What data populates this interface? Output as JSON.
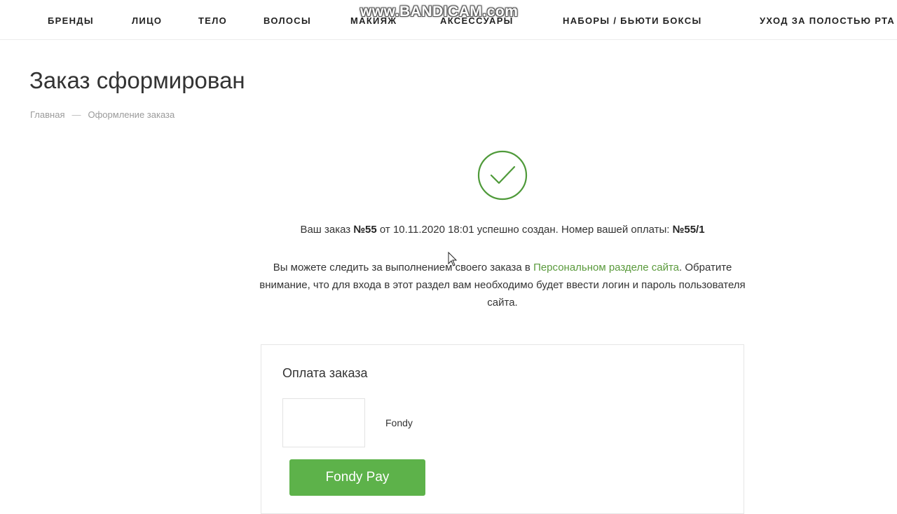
{
  "nav": {
    "items": [
      {
        "label": "БРЕНДЫ"
      },
      {
        "label": "ЛИЦО"
      },
      {
        "label": "ТЕЛО"
      },
      {
        "label": "ВОЛОСЫ"
      },
      {
        "label": "МАКИЯЖ"
      },
      {
        "label": "АКСЕССУАРЫ"
      },
      {
        "label": "НАБОРЫ / БЬЮТИ БОКСЫ"
      },
      {
        "label": "УХОД ЗА ПОЛОСТЬЮ РТА"
      }
    ]
  },
  "watermark": "www.BANDICAM.com",
  "page": {
    "title": "Заказ сформирован",
    "breadcrumb": [
      "Главная",
      "Оформление заказа"
    ],
    "breadcrumb_separator": "—"
  },
  "order": {
    "prefix": "Ваш заказ",
    "number": "№55",
    "date_text": "от 10.11.2020 18:01 успешно создан. Номер вашей оплаты:",
    "payment_number": "№55/1"
  },
  "info": {
    "text_before_link": "Вы можете следить за выполнением своего заказа в",
    "link": "Персональном разделе сайта",
    "text_after_link": ".",
    "note": "Обратите внимание, что для входа в этот раздел вам необходимо будет ввести логин и пароль пользователя сайта."
  },
  "payment": {
    "title": "Оплата заказа",
    "method_name": "Fondy",
    "button_label": "Fondy Pay"
  },
  "colors": {
    "accent_green": "#5db24a",
    "link_green": "#5a9a3c",
    "check_green": "#4f9a3a"
  },
  "icons": {
    "success": "checkmark-circle-icon",
    "cursor": "mouse-cursor-icon"
  }
}
